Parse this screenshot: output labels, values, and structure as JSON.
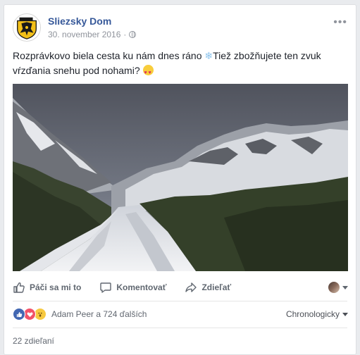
{
  "post": {
    "page_name": "Sliezsky Dom",
    "date": "30. november 2016",
    "separator": "·",
    "privacy_icon": "globe-icon",
    "more_icon": "more-icon",
    "message_part1": "Rozprávkovo biela cesta ku nám dnes ráno ",
    "message_emoji1": "❄",
    "message_part2": "Tiež zbožňujete ten zvuk vŕzďania snehu pod nohami? ",
    "message_emoji2": "heart-eyes"
  },
  "actions": {
    "like": "Páči sa mi to",
    "comment": "Komentovať",
    "share": "Zdieľať"
  },
  "reactions": {
    "types": [
      "like",
      "love",
      "wow"
    ],
    "summary": "Adam Peer a 724 ďalších",
    "sort": "Chronologicky"
  },
  "shares": "22 zdieľaní",
  "colors": {
    "link": "#365899",
    "like": "#4267b2",
    "love": "#f25268",
    "wow": "#f7c940"
  }
}
